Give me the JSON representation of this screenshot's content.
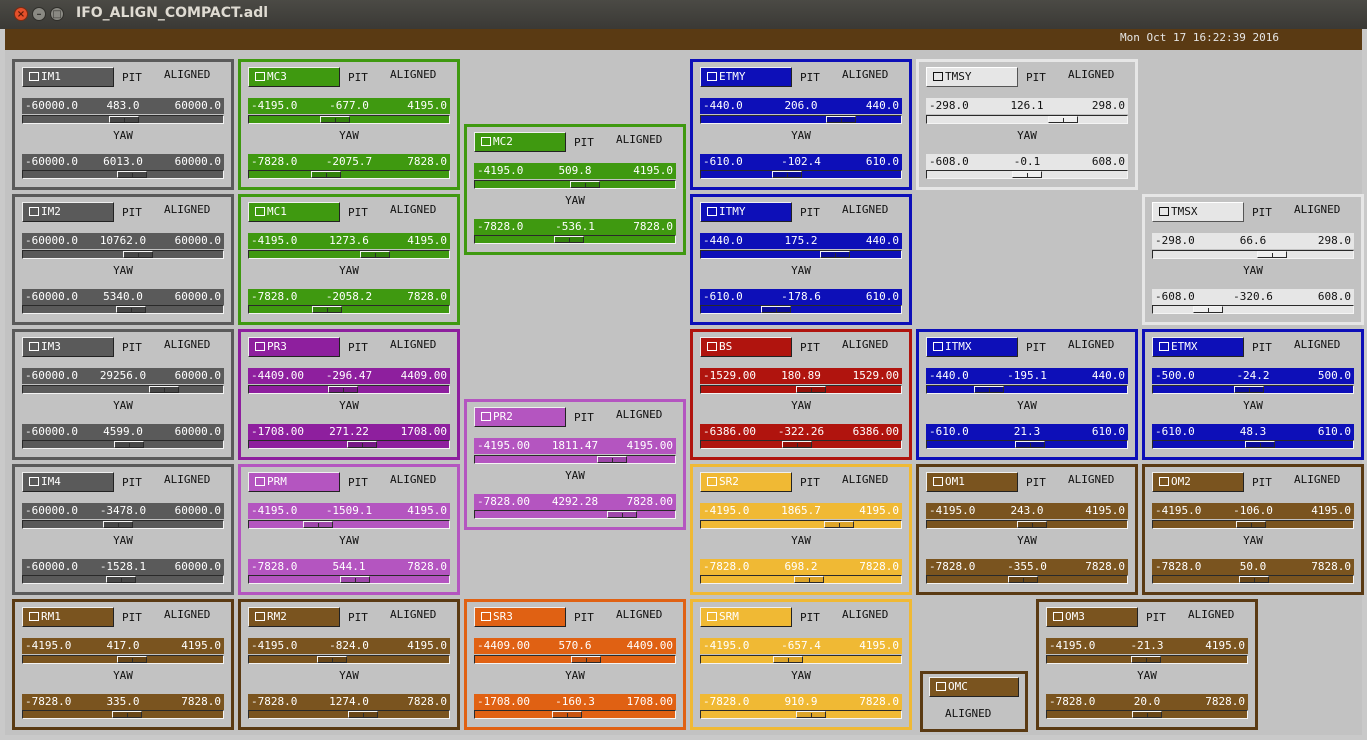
{
  "window": {
    "title": "IFO_ALIGN_COMPACT.adl",
    "timestamp": "Mon Oct 17 16:22:39 2016"
  },
  "colors": {
    "gray": "#5a5a5a",
    "green": "#3f9910",
    "blue": "#0d0fb8",
    "white": "#e6e6e6",
    "purple": "#8e1f9e",
    "lpurple": "#b455c0",
    "red": "#b0140e",
    "yellow": "#f0b934",
    "brown": "#7a541f",
    "orange": "#e06113"
  },
  "panels": [
    {
      "name": "IM1",
      "color": "gray",
      "pit_label": "PIT",
      "status": "ALIGNED",
      "yaw_label": "YAW",
      "pit": {
        "min": "-60000.0",
        "value": "483.0",
        "max": "60000.0",
        "level": 0.504
      },
      "yaw": {
        "min": "-60000.0",
        "value": "6013.0",
        "max": "60000.0",
        "level": 0.55
      }
    },
    {
      "name": "IM2",
      "color": "gray",
      "pit_label": "PIT",
      "status": "ALIGNED",
      "yaw_label": "YAW",
      "pit": {
        "min": "-60000.0",
        "value": "10762.0",
        "max": "60000.0",
        "level": 0.59
      },
      "yaw": {
        "min": "-60000.0",
        "value": "5340.0",
        "max": "60000.0",
        "level": 0.545
      }
    },
    {
      "name": "IM3",
      "color": "gray",
      "pit_label": "PIT",
      "status": "ALIGNED",
      "yaw_label": "YAW",
      "pit": {
        "min": "-60000.0",
        "value": "29256.0",
        "max": "60000.0",
        "level": 0.744
      },
      "yaw": {
        "min": "-60000.0",
        "value": "4599.0",
        "max": "60000.0",
        "level": 0.538
      }
    },
    {
      "name": "IM4",
      "color": "gray",
      "pit_label": "PIT",
      "status": "ALIGNED",
      "yaw_label": "YAW",
      "pit": {
        "min": "-60000.0",
        "value": "-3478.0",
        "max": "60000.0",
        "level": 0.471
      },
      "yaw": {
        "min": "-60000.0",
        "value": "-1528.1",
        "max": "60000.0",
        "level": 0.487
      }
    },
    {
      "name": "RM1",
      "color": "brown",
      "pit_label": "PIT",
      "status": "ALIGNED",
      "yaw_label": "YAW",
      "pit": {
        "min": "-4195.0",
        "value": "417.0",
        "max": "4195.0",
        "level": 0.55
      },
      "yaw": {
        "min": "-7828.0",
        "value": "335.0",
        "max": "7828.0",
        "level": 0.521
      }
    },
    {
      "name": "MC3",
      "color": "green",
      "pit_label": "PIT",
      "status": "ALIGNED",
      "yaw_label": "YAW",
      "pit": {
        "min": "-4195.0",
        "value": "-677.0",
        "max": "4195.0",
        "level": 0.419
      },
      "yaw": {
        "min": "-7828.0",
        "value": "-2075.7",
        "max": "7828.0",
        "level": 0.367
      }
    },
    {
      "name": "MC1",
      "color": "green",
      "pit_label": "PIT",
      "status": "ALIGNED",
      "yaw_label": "YAW",
      "pit": {
        "min": "-4195.0",
        "value": "1273.6",
        "max": "4195.0",
        "level": 0.652
      },
      "yaw": {
        "min": "-7828.0",
        "value": "-2058.2",
        "max": "7828.0",
        "level": 0.369
      }
    },
    {
      "name": "PR3",
      "color": "purple",
      "pit_label": "PIT",
      "status": "ALIGNED",
      "yaw_label": "YAW",
      "pit": {
        "min": "-4409.00",
        "value": "-296.47",
        "max": "4409.00",
        "level": 0.466
      },
      "yaw": {
        "min": "-1708.00",
        "value": "271.22",
        "max": "1708.00",
        "level": 0.579
      }
    },
    {
      "name": "PRM",
      "color": "lpurple",
      "pit_label": "PIT",
      "status": "ALIGNED",
      "yaw_label": "YAW",
      "pit": {
        "min": "-4195.0",
        "value": "-1509.1",
        "max": "4195.0",
        "level": 0.32
      },
      "yaw": {
        "min": "-7828.0",
        "value": "544.1",
        "max": "7828.0",
        "level": 0.535
      }
    },
    {
      "name": "RM2",
      "color": "brown",
      "pit_label": "PIT",
      "status": "ALIGNED",
      "yaw_label": "YAW",
      "pit": {
        "min": "-4195.0",
        "value": "-824.0",
        "max": "4195.0",
        "level": 0.402
      },
      "yaw": {
        "min": "-7828.0",
        "value": "1274.0",
        "max": "7828.0",
        "level": 0.581
      }
    },
    {
      "name": "MC2",
      "color": "green",
      "pit_label": "PIT",
      "status": "ALIGNED",
      "yaw_label": "YAW",
      "pit": {
        "min": "-4195.0",
        "value": "509.8",
        "max": "4195.0",
        "level": 0.561
      },
      "yaw": {
        "min": "-7828.0",
        "value": "-536.1",
        "max": "7828.0",
        "level": 0.466
      }
    },
    {
      "name": "PR2",
      "color": "lpurple",
      "pit_label": "PIT",
      "status": "ALIGNED",
      "yaw_label": "YAW",
      "pit": {
        "min": "-4195.00",
        "value": "1811.47",
        "max": "4195.00",
        "level": 0.716
      },
      "yaw": {
        "min": "-7828.00",
        "value": "4292.28",
        "max": "7828.00",
        "level": 0.774
      }
    },
    {
      "name": "SR3",
      "color": "orange",
      "pit_label": "PIT",
      "status": "ALIGNED",
      "yaw_label": "YAW",
      "pit": {
        "min": "-4409.00",
        "value": "570.6",
        "max": "4409.00",
        "level": 0.565
      },
      "yaw": {
        "min": "-1708.00",
        "value": "-160.3",
        "max": "1708.00",
        "level": 0.453
      }
    },
    {
      "name": "ETMY",
      "color": "blue",
      "pit_label": "PIT",
      "status": "ALIGNED",
      "yaw_label": "YAW",
      "pit": {
        "min": "-440.0",
        "value": "206.0",
        "max": "440.0",
        "level": 0.734
      },
      "yaw": {
        "min": "-610.0",
        "value": "-102.4",
        "max": "610.0",
        "level": 0.416
      }
    },
    {
      "name": "ITMY",
      "color": "blue",
      "pit_label": "PIT",
      "status": "ALIGNED",
      "yaw_label": "YAW",
      "pit": {
        "min": "-440.0",
        "value": "175.2",
        "max": "440.0",
        "level": 0.699
      },
      "yaw": {
        "min": "-610.0",
        "value": "-178.6",
        "max": "610.0",
        "level": 0.354
      }
    },
    {
      "name": "BS",
      "color": "red",
      "pit_label": "PIT",
      "status": "ALIGNED",
      "yaw_label": "YAW",
      "pit": {
        "min": "-1529.00",
        "value": "180.89",
        "max": "1529.00",
        "level": 0.559
      },
      "yaw": {
        "min": "-6386.00",
        "value": "-322.26",
        "max": "6386.00",
        "level": 0.475
      }
    },
    {
      "name": "SR2",
      "color": "yellow",
      "pit_label": "PIT",
      "status": "ALIGNED",
      "yaw_label": "YAW",
      "pit": {
        "min": "-4195.0",
        "value": "1865.7",
        "max": "4195.0",
        "level": 0.722
      },
      "yaw": {
        "min": "-7828.0",
        "value": "698.2",
        "max": "7828.0",
        "level": 0.545
      }
    },
    {
      "name": "SRM",
      "color": "yellow",
      "pit_label": "PIT",
      "status": "ALIGNED",
      "yaw_label": "YAW",
      "pit": {
        "min": "-4195.0",
        "value": "-657.4",
        "max": "4195.0",
        "level": 0.422
      },
      "yaw": {
        "min": "-7828.0",
        "value": "910.9",
        "max": "7828.0",
        "level": 0.558
      }
    },
    {
      "name": "TMSY",
      "color": "white",
      "pit_label": "PIT",
      "status": "ALIGNED",
      "yaw_label": "YAW",
      "pit": {
        "min": "-298.0",
        "value": "126.1",
        "max": "298.0",
        "level": 0.712
      },
      "yaw": {
        "min": "-608.0",
        "value": "-0.1",
        "max": "608.0",
        "level": 0.5
      }
    },
    {
      "name": "ITMX",
      "color": "blue",
      "pit_label": "PIT",
      "status": "ALIGNED",
      "yaw_label": "YAW",
      "pit": {
        "min": "-440.0",
        "value": "-195.1",
        "max": "440.0",
        "level": 0.278
      },
      "yaw": {
        "min": "-610.0",
        "value": "21.3",
        "max": "610.0",
        "level": 0.517
      }
    },
    {
      "name": "OM1",
      "color": "brown",
      "pit_label": "PIT",
      "status": "ALIGNED",
      "yaw_label": "YAW",
      "pit": {
        "min": "-4195.0",
        "value": "243.0",
        "max": "4195.0",
        "level": 0.529
      },
      "yaw": {
        "min": "-7828.0",
        "value": "-355.0",
        "max": "7828.0",
        "level": 0.477
      }
    },
    {
      "name": "TMSX",
      "color": "white",
      "pit_label": "PIT",
      "status": "ALIGNED",
      "yaw_label": "YAW",
      "pit": {
        "min": "-298.0",
        "value": "66.6",
        "max": "298.0",
        "level": 0.612
      },
      "yaw": {
        "min": "-608.0",
        "value": "-320.6",
        "max": "608.0",
        "level": 0.236
      }
    },
    {
      "name": "ETMX",
      "color": "blue",
      "pit_label": "PIT",
      "status": "ALIGNED",
      "yaw_label": "YAW",
      "pit": {
        "min": "-500.0",
        "value": "-24.2",
        "max": "500.0",
        "level": 0.476
      },
      "yaw": {
        "min": "-610.0",
        "value": "48.3",
        "max": "610.0",
        "level": 0.54
      }
    },
    {
      "name": "OM2",
      "color": "brown",
      "pit_label": "PIT",
      "status": "ALIGNED",
      "yaw_label": "YAW",
      "pit": {
        "min": "-4195.0",
        "value": "-106.0",
        "max": "4195.0",
        "level": 0.487
      },
      "yaw": {
        "min": "-7828.0",
        "value": "50.0",
        "max": "7828.0",
        "level": 0.503
      }
    },
    {
      "name": "OM3",
      "color": "brown",
      "pit_label": "PIT",
      "status": "ALIGNED",
      "yaw_label": "YAW",
      "pit": {
        "min": "-4195.0",
        "value": "-21.3",
        "max": "4195.0",
        "level": 0.497
      },
      "yaw": {
        "min": "-7828.0",
        "value": "20.0",
        "max": "7828.0",
        "level": 0.501
      }
    }
  ],
  "omc": {
    "name": "OMC",
    "color": "brown",
    "status": "ALIGNED"
  }
}
